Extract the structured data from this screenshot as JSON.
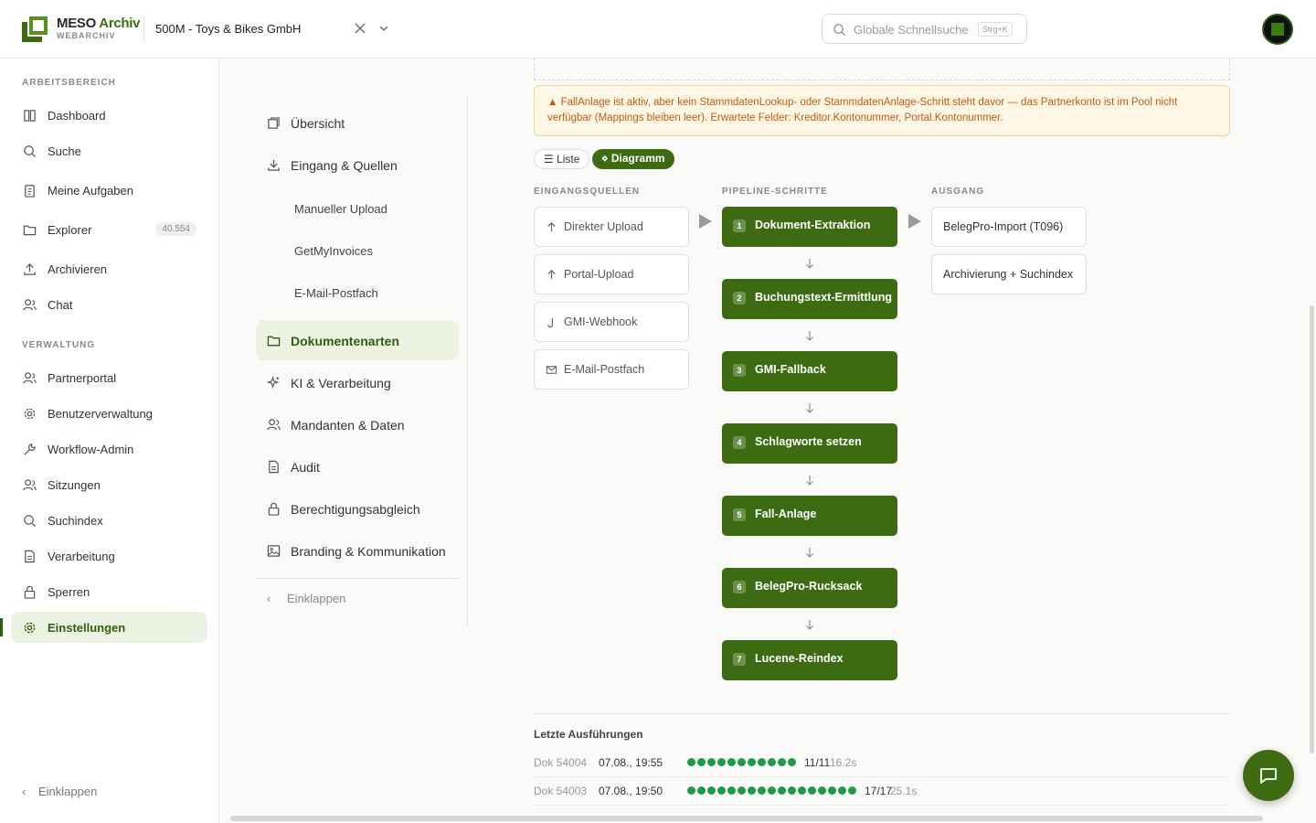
{
  "header": {
    "brand_main": "MESO",
    "brand_accent": "Archiv",
    "brand_sub": "WEBARCHIV",
    "tenant": "500M - Toys & Bikes GmbH",
    "search_placeholder": "Globale Schnellsuche",
    "search_shortcut": "Strg+K"
  },
  "sidebar": {
    "section_workspace": "ARBEITSBEREICH",
    "section_admin": "VERWALTUNG",
    "items": [
      {
        "label": "Dashboard",
        "icon": "columns-icon"
      },
      {
        "label": "Suche",
        "icon": "search-icon"
      },
      {
        "label": "Meine Aufgaben",
        "icon": "clipboard-icon"
      },
      {
        "label": "Explorer",
        "icon": "folder-icon",
        "badge": "40.554"
      },
      {
        "label": "Archivieren",
        "icon": "upload-icon"
      },
      {
        "label": "Chat",
        "icon": "users-icon"
      },
      {
        "label": "Partnerportal",
        "icon": "users-icon"
      },
      {
        "label": "Benutzerverwaltung",
        "icon": "gear-icon"
      },
      {
        "label": "Workflow-Admin",
        "icon": "wrench-icon"
      },
      {
        "label": "Sitzungen",
        "icon": "users-icon"
      },
      {
        "label": "Suchindex",
        "icon": "search-icon"
      },
      {
        "label": "Verarbeitung",
        "icon": "document-icon"
      },
      {
        "label": "Sperren",
        "icon": "lock-icon"
      },
      {
        "label": "Einstellungen",
        "icon": "gear-icon"
      }
    ],
    "collapse": "Einklappen"
  },
  "settings_nav": {
    "items": [
      {
        "label": "Übersicht",
        "icon": "copy-icon"
      },
      {
        "label": "Eingang & Quellen",
        "icon": "download-icon"
      },
      {
        "label": "Manueller Upload"
      },
      {
        "label": "GetMyInvoices"
      },
      {
        "label": "E-Mail-Postfach"
      },
      {
        "label": "Dokumentenarten",
        "icon": "folder-icon"
      },
      {
        "label": "KI & Verarbeitung",
        "icon": "sparkles-icon"
      },
      {
        "label": "Mandanten & Daten",
        "icon": "users-icon"
      },
      {
        "label": "Audit",
        "icon": "document-icon"
      },
      {
        "label": "Berechtigungsabgleich",
        "icon": "lock-icon"
      },
      {
        "label": "Branding & Kommunikation",
        "icon": "image-icon"
      }
    ],
    "collapse": "Einklappen"
  },
  "main": {
    "warning": "▲ FallAnlage ist aktiv, aber kein StammdatenLookup- oder StammdatenAnlage-Schritt steht davor — das Partnerkonto ist im Pool nicht verfügbar (Mappings bleiben leer). Erwartete Felder: Kreditor.Kontonummer, Portal.Kontonummer.",
    "view_list": "☰ Liste",
    "view_diagram": "⋄ Diagramm",
    "col_sources": "EINGANGSQUELLEN",
    "col_steps": "PIPELINE-SCHRITTE",
    "col_output": "AUSGANG",
    "sources": [
      {
        "label": "Direkter Upload",
        "icon": "arrow-up-icon"
      },
      {
        "label": "Portal-Upload",
        "icon": "arrow-up-icon"
      },
      {
        "label": "GMI-Webhook",
        "icon": "hook-icon"
      },
      {
        "label": "E-Mail-Postfach",
        "icon": "mail-icon"
      }
    ],
    "steps": [
      {
        "num": "1",
        "label": "Dokument-Extraktion"
      },
      {
        "num": "2",
        "label": "Buchungstext-Ermittlung"
      },
      {
        "num": "3",
        "label": "GMI-Fallback"
      },
      {
        "num": "4",
        "label": "Schlagworte setzen"
      },
      {
        "num": "5",
        "label": "Fall-Anlage"
      },
      {
        "num": "6",
        "label": "BelegPro-Rucksack"
      },
      {
        "num": "7",
        "label": "Lucene-Reindex"
      }
    ],
    "outputs": [
      {
        "label": "BelegPro-Import (T096)"
      },
      {
        "label": "Archivierung + Suchindex"
      }
    ],
    "runs_title": "Letzte Ausführungen",
    "runs": [
      {
        "doc": "Dok 54004",
        "time": "07.08., 19:55",
        "dots": 11,
        "count": "11/11",
        "duration": "16.2s"
      },
      {
        "doc": "Dok 54003",
        "time": "07.08., 19:50",
        "dots": 17,
        "count": "17/17",
        "duration": "25.1s"
      }
    ]
  },
  "colors": {
    "accent": "#3d6b12",
    "success": "#1e9a4a",
    "warning": "#c25a10"
  }
}
